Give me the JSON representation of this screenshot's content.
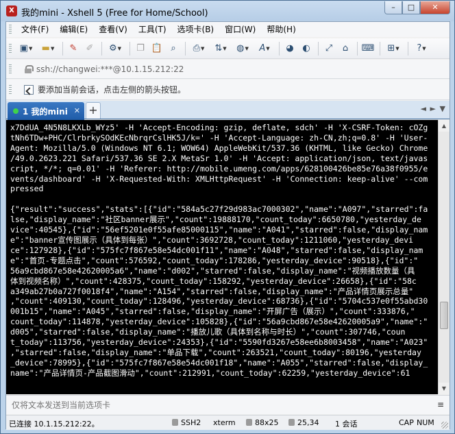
{
  "window": {
    "title": "我的mini - Xshell 5 (Free for Home/School)",
    "app_icon_letter": "X",
    "minimize": "–",
    "maximize": "□",
    "close": "✕"
  },
  "menu": [
    "文件(F)",
    "编辑(E)",
    "查看(V)",
    "工具(T)",
    "选项卡(B)",
    "窗口(W)",
    "帮助(H)"
  ],
  "toolbar": {
    "icons": [
      "new-session-icon",
      "open-folder-icon",
      "connect-icon",
      "disconnect-icon",
      "properties-icon",
      "copy-icon",
      "paste-icon",
      "find-icon",
      "print-icon",
      "transfer-icon",
      "globe-icon",
      "font-icon",
      "xftp-icon",
      "xmanager-icon",
      "fullscreen-icon",
      "lock-screen-icon",
      "keyboard-icon",
      "add-icon",
      "help-icon"
    ]
  },
  "address": {
    "text": "ssh://changwei:***@10.1.15.212:22"
  },
  "hint": {
    "text": "要添加当前会话，点击左侧的箭头按钮。"
  },
  "tabs": {
    "active_label": "1 我的mini",
    "close": "✕",
    "add": "+",
    "prev": "◄",
    "next": "►",
    "menu": "▼"
  },
  "terminal": {
    "lines": [
      "x7DdUA_4N5N8LKXLb_WYz5' -H 'Accept-Encoding: gzip, deflate, sdch' -H 'X-CSRF-Token: cOZg",
      "tNh6TDw+PHC/ClrbrkySOdKEcNbrqrCslHK5J/k=' -H 'Accept-Language: zh-CN,zh;q=0.8' -H 'User-",
      "Agent: Mozilla/5.0 (Windows NT 6.1; WOW64) AppleWebKit/537.36 (KHTML, like Gecko) Chrome",
      "/49.0.2623.221 Safari/537.36 SE 2.X MetaSr 1.0' -H 'Accept: application/json, text/javas",
      "cript, */*; q=0.01' -H 'Referer: http://mobile.umeng.com/apps/628100426be85e76a38f0955/e",
      "vents/dashboard' -H 'X-Requested-With: XMLHttpRequest' -H 'Connection: keep-alive' --com",
      "pressed",
      "",
      "{\"result\":\"success\",\"stats\":[{\"id\":\"584a5c27f29d983ac7000302\",\"name\":\"A097\",\"starred\":fa",
      "lse,\"display_name\":\"社区banner展示\",\"count\":19888170,\"count_today\":6650780,\"yesterday_de",
      "vice\":40545},{\"id\":\"56ef5201e0f55afe85000115\",\"name\":\"A041\",\"starred\":false,\"display_nam",
      "e\":\"banner宣传图展示（具体到每张）\",\"count\":3692728,\"count_today\":1211060,\"yesterday_devi",
      "ce\":127928},{\"id\":\"575fc7f867e58e54dc001f11\",\"name\":\"A048\",\"starred\":false,\"display_nam",
      "e\":\"首页-专题点击\",\"count\":576592,\"count_today\":178286,\"yesterday_device\":90518},{\"id\":\"",
      "56a9cbd867e58e42620005a6\",\"name\":\"d002\",\"starred\":false,\"display_name\":\"视频播放数量（具",
      "体到视频名称）\",\"count\":428375,\"count_today\":158292,\"yesterday_device\":26658},{\"id\":\"58c",
      "a349ab27b0a727f0018f4\",\"name\":\"A154\",\"starred\":false,\"display_name\":\"产品详情页展示总量\"",
      ",\"count\":409130,\"count_today\":128496,\"yesterday_device\":68736},{\"id\":\"5704c537e0f55abd30",
      "001b15\",\"name\":\"A045\",\"starred\":false,\"display_name\":\"开屏广告（展示）\",\"count\":333876,\"",
      "count_today\":114878,\"yesterday_device\":105828},{\"id\":\"56a9cbd867e58e42620005a9\",\"name\":\"",
      "d005\",\"starred\":false,\"display_name\":\"播放儿歌（具体到名称与时长）\",\"count\":307746,\"coun",
      "t_today\":113756,\"yesterday_device\":24353},{\"id\":\"5590fd3267e58ee6b8003458\",\"name\":\"A023\"",
      ",\"starred\":false,\"display_name\":\"单品下载\",\"count\":263521,\"count_today\":80196,\"yesterday",
      "_device\":78995},{\"id\":\"575fc7f867e58e54dc001f18\",\"name\":\"A055\",\"starred\":false,\"display_",
      "name\":\"产品详情页-产品截图滑动\",\"count\":212991,\"count_today\":62259,\"yesterday_device\":61"
    ]
  },
  "sendbar": {
    "placeholder": "仅将文本发送到当前选项卡",
    "menu": "≡"
  },
  "status": {
    "connection": "已连接 10.1.15.212:22。",
    "protocol": "SSH2",
    "terminal": "xterm",
    "size": "88x25",
    "position": "25,34",
    "sessions": "1 会话",
    "caps": "CAP",
    "num": "NUM"
  },
  "colors": {
    "terminal_bg": "#000000",
    "terminal_fg": "#ffffff",
    "tab_active": "#2a68b6",
    "title_bar": "#bcd3ea"
  }
}
